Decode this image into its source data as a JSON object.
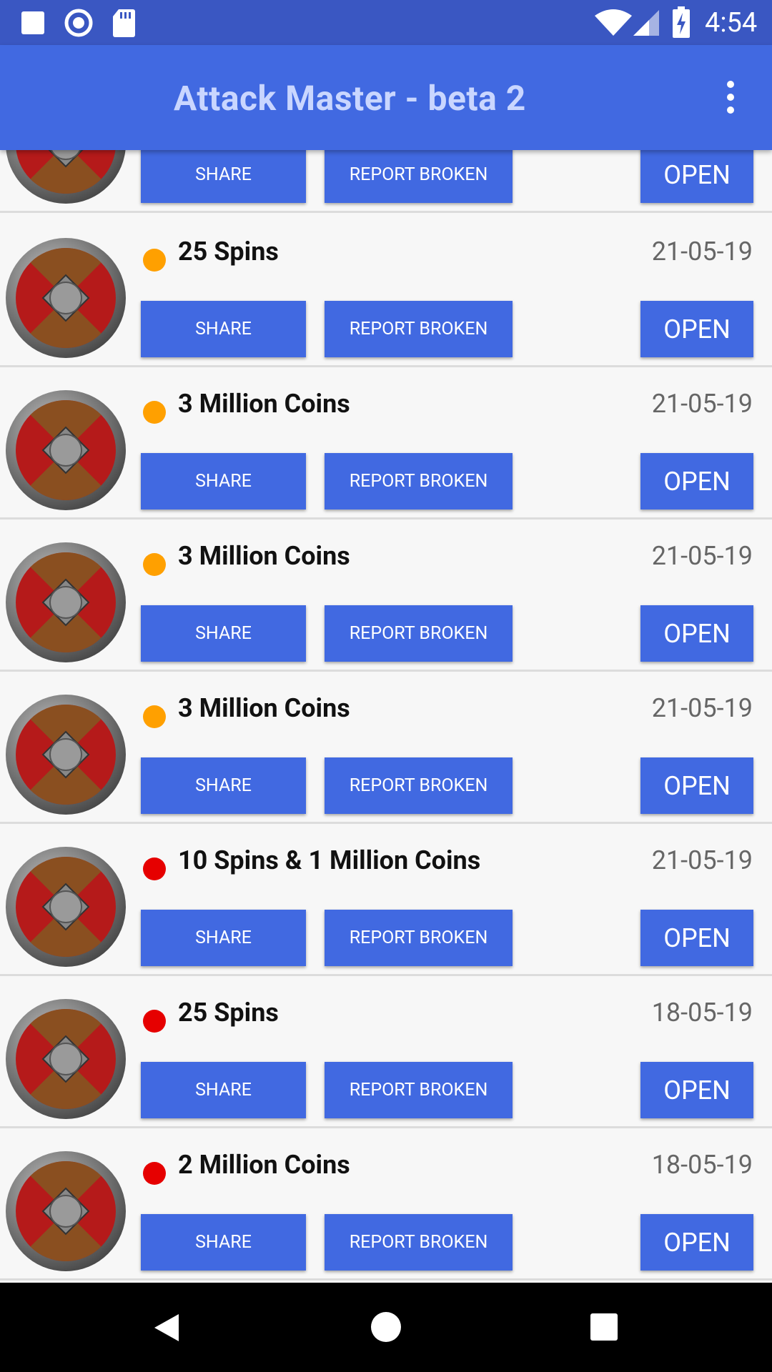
{
  "status_bar": {
    "time": "4:54",
    "icons": [
      "square-notification-icon",
      "circle-notification-icon",
      "sd-card-icon",
      "wifi-icon",
      "signal-icon",
      "battery-charging-icon"
    ]
  },
  "app_bar": {
    "title": "Attack Master - beta 2",
    "menu_icon": "more-vert-icon"
  },
  "colors": {
    "primary": "#4169e1",
    "status_bar": "#3a57c2",
    "dot_orange": "#ffa000",
    "dot_red": "#e60000"
  },
  "buttons": {
    "share": "SHARE",
    "report": "REPORT BROKEN",
    "open": "OPEN"
  },
  "items": [
    {
      "title": "",
      "date": "",
      "status": ""
    },
    {
      "title": "25 Spins",
      "date": "21-05-19",
      "status": "orange"
    },
    {
      "title": "3 Million Coins",
      "date": "21-05-19",
      "status": "orange"
    },
    {
      "title": "3 Million Coins",
      "date": "21-05-19",
      "status": "orange"
    },
    {
      "title": "3 Million Coins",
      "date": "21-05-19",
      "status": "orange"
    },
    {
      "title": "10 Spins & 1 Million Coins",
      "date": "21-05-19",
      "status": "red"
    },
    {
      "title": "25 Spins",
      "date": "18-05-19",
      "status": "red"
    },
    {
      "title": "2 Million Coins",
      "date": "18-05-19",
      "status": "red"
    }
  ],
  "nav_bar": {
    "icons": [
      "back-icon",
      "home-icon",
      "recents-icon"
    ]
  }
}
